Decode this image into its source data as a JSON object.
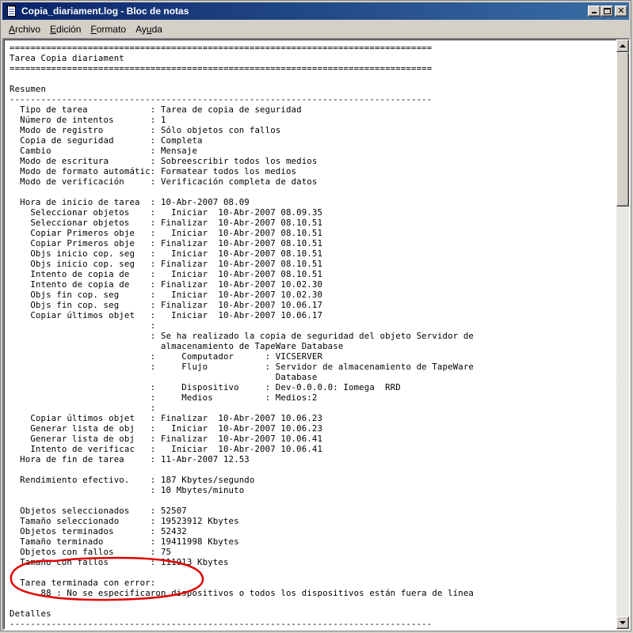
{
  "window": {
    "title": "Copia_diariament.log - Bloc de notas"
  },
  "menu": {
    "items": [
      {
        "pre": "",
        "key": "A",
        "post": "rchivo"
      },
      {
        "pre": "",
        "key": "E",
        "post": "dición"
      },
      {
        "pre": "",
        "key": "F",
        "post": "ormato"
      },
      {
        "pre": "Ay",
        "key": "u",
        "post": "da"
      }
    ]
  },
  "annotation": {
    "color": "#e00000"
  },
  "document": {
    "lines": [
      "=================================================================================",
      "Tarea Copia diariament",
      "=================================================================================",
      "",
      "Resumen",
      "---------------------------------------------------------------------------------",
      "  Tipo de tarea            : Tarea de copia de seguridad",
      "  Número de intentos       : 1",
      "  Modo de registro         : Sólo objetos con fallos",
      "  Copia de seguridad       : Completa",
      "  Cambio                   : Mensaje",
      "  Modo de escritura        : Sobreescribir todos los medios",
      "  Modo de formato automátic: Formatear todos los medios",
      "  Modo de verificación     : Verificación completa de datos",
      "",
      "  Hora de inicio de tarea  : 10-Abr-2007 08.09",
      "    Seleccionar objetos    :   Iniciar  10-Abr-2007 08.09.35",
      "    Seleccionar objetos    : Finalizar  10-Abr-2007 08.10.51",
      "    Copiar Primeros obje   :   Iniciar  10-Abr-2007 08.10.51",
      "    Copiar Primeros obje   : Finalizar  10-Abr-2007 08.10.51",
      "    Objs inicio cop. seg   :   Iniciar  10-Abr-2007 08.10.51",
      "    Objs inicio cop. seg   : Finalizar  10-Abr-2007 08.10.51",
      "    Intento de copia de    :   Iniciar  10-Abr-2007 08.10.51",
      "    Intento de copia de    : Finalizar  10-Abr-2007 10.02.30",
      "    Objs fin cop. seg      :   Iniciar  10-Abr-2007 10.02.30",
      "    Objs fin cop. seg      : Finalizar  10-Abr-2007 10.06.17",
      "    Copiar últimos objet   :   Iniciar  10-Abr-2007 10.06.17",
      "                           :",
      "                           : Se ha realizado la copia de seguridad del objeto Servidor de",
      "                             almacenamiento de TapeWare Database",
      "                           :     Computador      : VICSERVER",
      "                           :     Flujo           : Servidor de almacenamiento de TapeWare",
      "                                                   Database",
      "                           :     Dispositivo     : Dev-0.0.0.0: Iomega  RRD",
      "                           :     Medios          : Medios:2",
      "                           :",
      "    Copiar últimos objet   : Finalizar  10-Abr-2007 10.06.23",
      "    Generar lista de obj   :   Iniciar  10-Abr-2007 10.06.23",
      "    Generar lista de obj   : Finalizar  10-Abr-2007 10.06.41",
      "    Intento de verificac   :   Iniciar  10-Abr-2007 10.06.41",
      "  Hora de fin de tarea     : 11-Abr-2007 12.53",
      "",
      "  Rendimiento efectivo.    : 187 Kbytes/segundo",
      "                           : 10 Mbytes/minuto",
      "",
      "  Objetos seleccionados    : 52507",
      "  Tamaño seleccionado      : 19523912 Kbytes",
      "  Objetos terminados       : 52432",
      "  Tamaño terminado         : 19411998 Kbytes",
      "  Objetos con fallos       : 75",
      "  Tamaño con fallos        : 111913 Kbytes",
      "",
      "  Tarea terminada con error:",
      "      88 : No se especificaron dispositivos o todos los dispositivos están fuera de línea",
      "",
      "Detalles",
      "---------------------------------------------------------------------------------"
    ]
  }
}
